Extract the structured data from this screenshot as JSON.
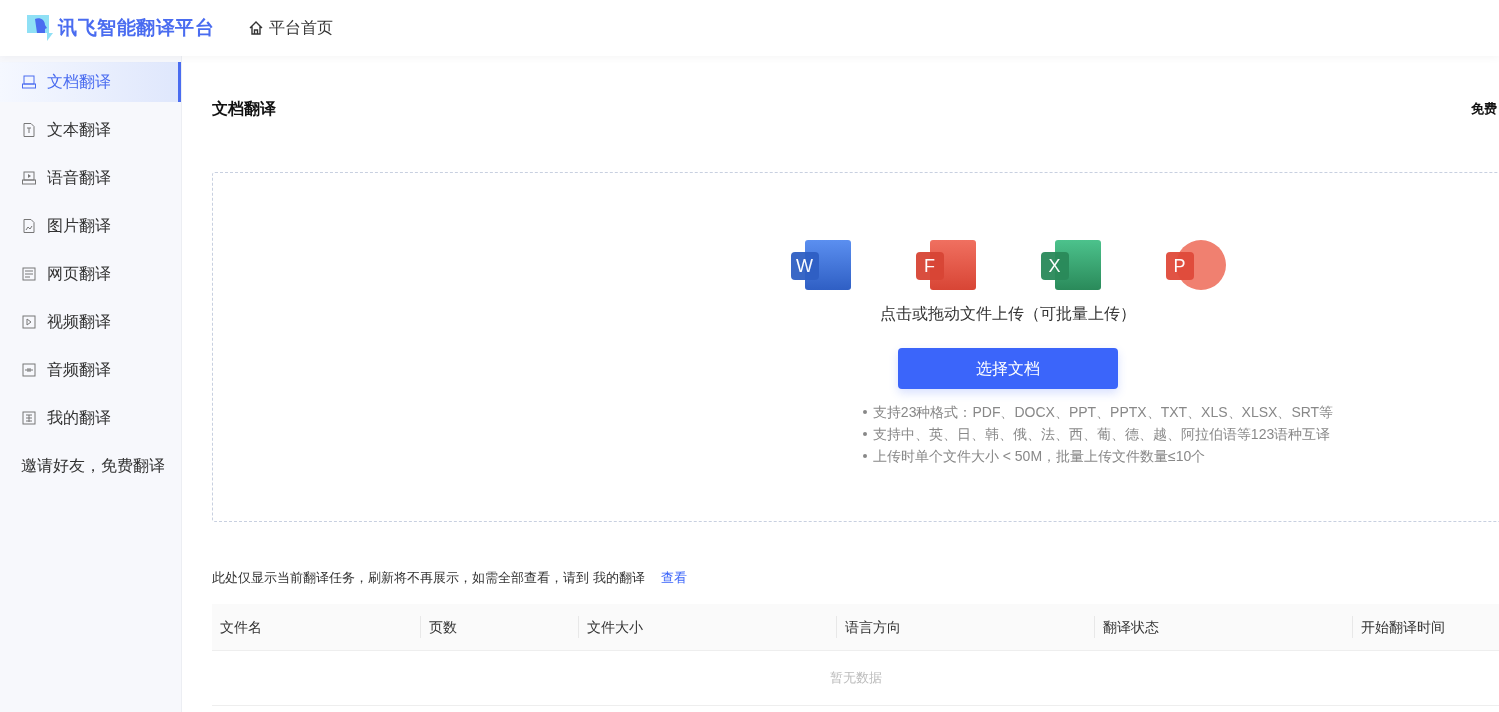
{
  "header": {
    "logo_text": "讯飞智能翻译平台",
    "home_link": "平台首页"
  },
  "sidebar": {
    "items": [
      {
        "label": "文档翻译",
        "kind": "doc",
        "selected": true
      },
      {
        "label": "文本翻译",
        "kind": "text",
        "selected": false
      },
      {
        "label": "语音翻译",
        "kind": "voice",
        "selected": false
      },
      {
        "label": "图片翻译",
        "kind": "image",
        "selected": false
      },
      {
        "label": "网页翻译",
        "kind": "web",
        "selected": false
      },
      {
        "label": "视频翻译",
        "kind": "video",
        "selected": false
      },
      {
        "label": "音频翻译",
        "kind": "audio",
        "selected": false
      },
      {
        "label": "我的翻译",
        "kind": "mine",
        "selected": false
      }
    ],
    "invite": "邀请好友，免费翻译"
  },
  "page": {
    "title": "文档翻译",
    "right_text": "免费"
  },
  "upload": {
    "file_types": [
      {
        "kind": "word",
        "letter": "W"
      },
      {
        "kind": "pdf",
        "letter": "F"
      },
      {
        "kind": "excel",
        "letter": "X"
      },
      {
        "kind": "ppt",
        "letter": "P"
      }
    ],
    "hint": "点击或拖动文件上传（可批量上传）",
    "button": "选择文档",
    "notes": [
      "支持23种格式：PDF、DOCX、PPT、PPTX、TXT、XLS、XLSX、SRT等",
      "支持中、英、日、韩、俄、法、西、葡、德、越、阿拉伯语等123语种互译",
      "上传时单个文件大小 < 50M，批量上传文件数量≤10个"
    ]
  },
  "tasks": {
    "notice": "此处仅显示当前翻译任务，刷新将不再展示，如需全部查看，请到 我的翻译",
    "notice_link": "查看",
    "table": {
      "columns": [
        "文件名",
        "页数",
        "文件大小",
        "语言方向",
        "翻译状态",
        "开始翻译时间"
      ],
      "empty_text": "暂无数据"
    }
  }
}
